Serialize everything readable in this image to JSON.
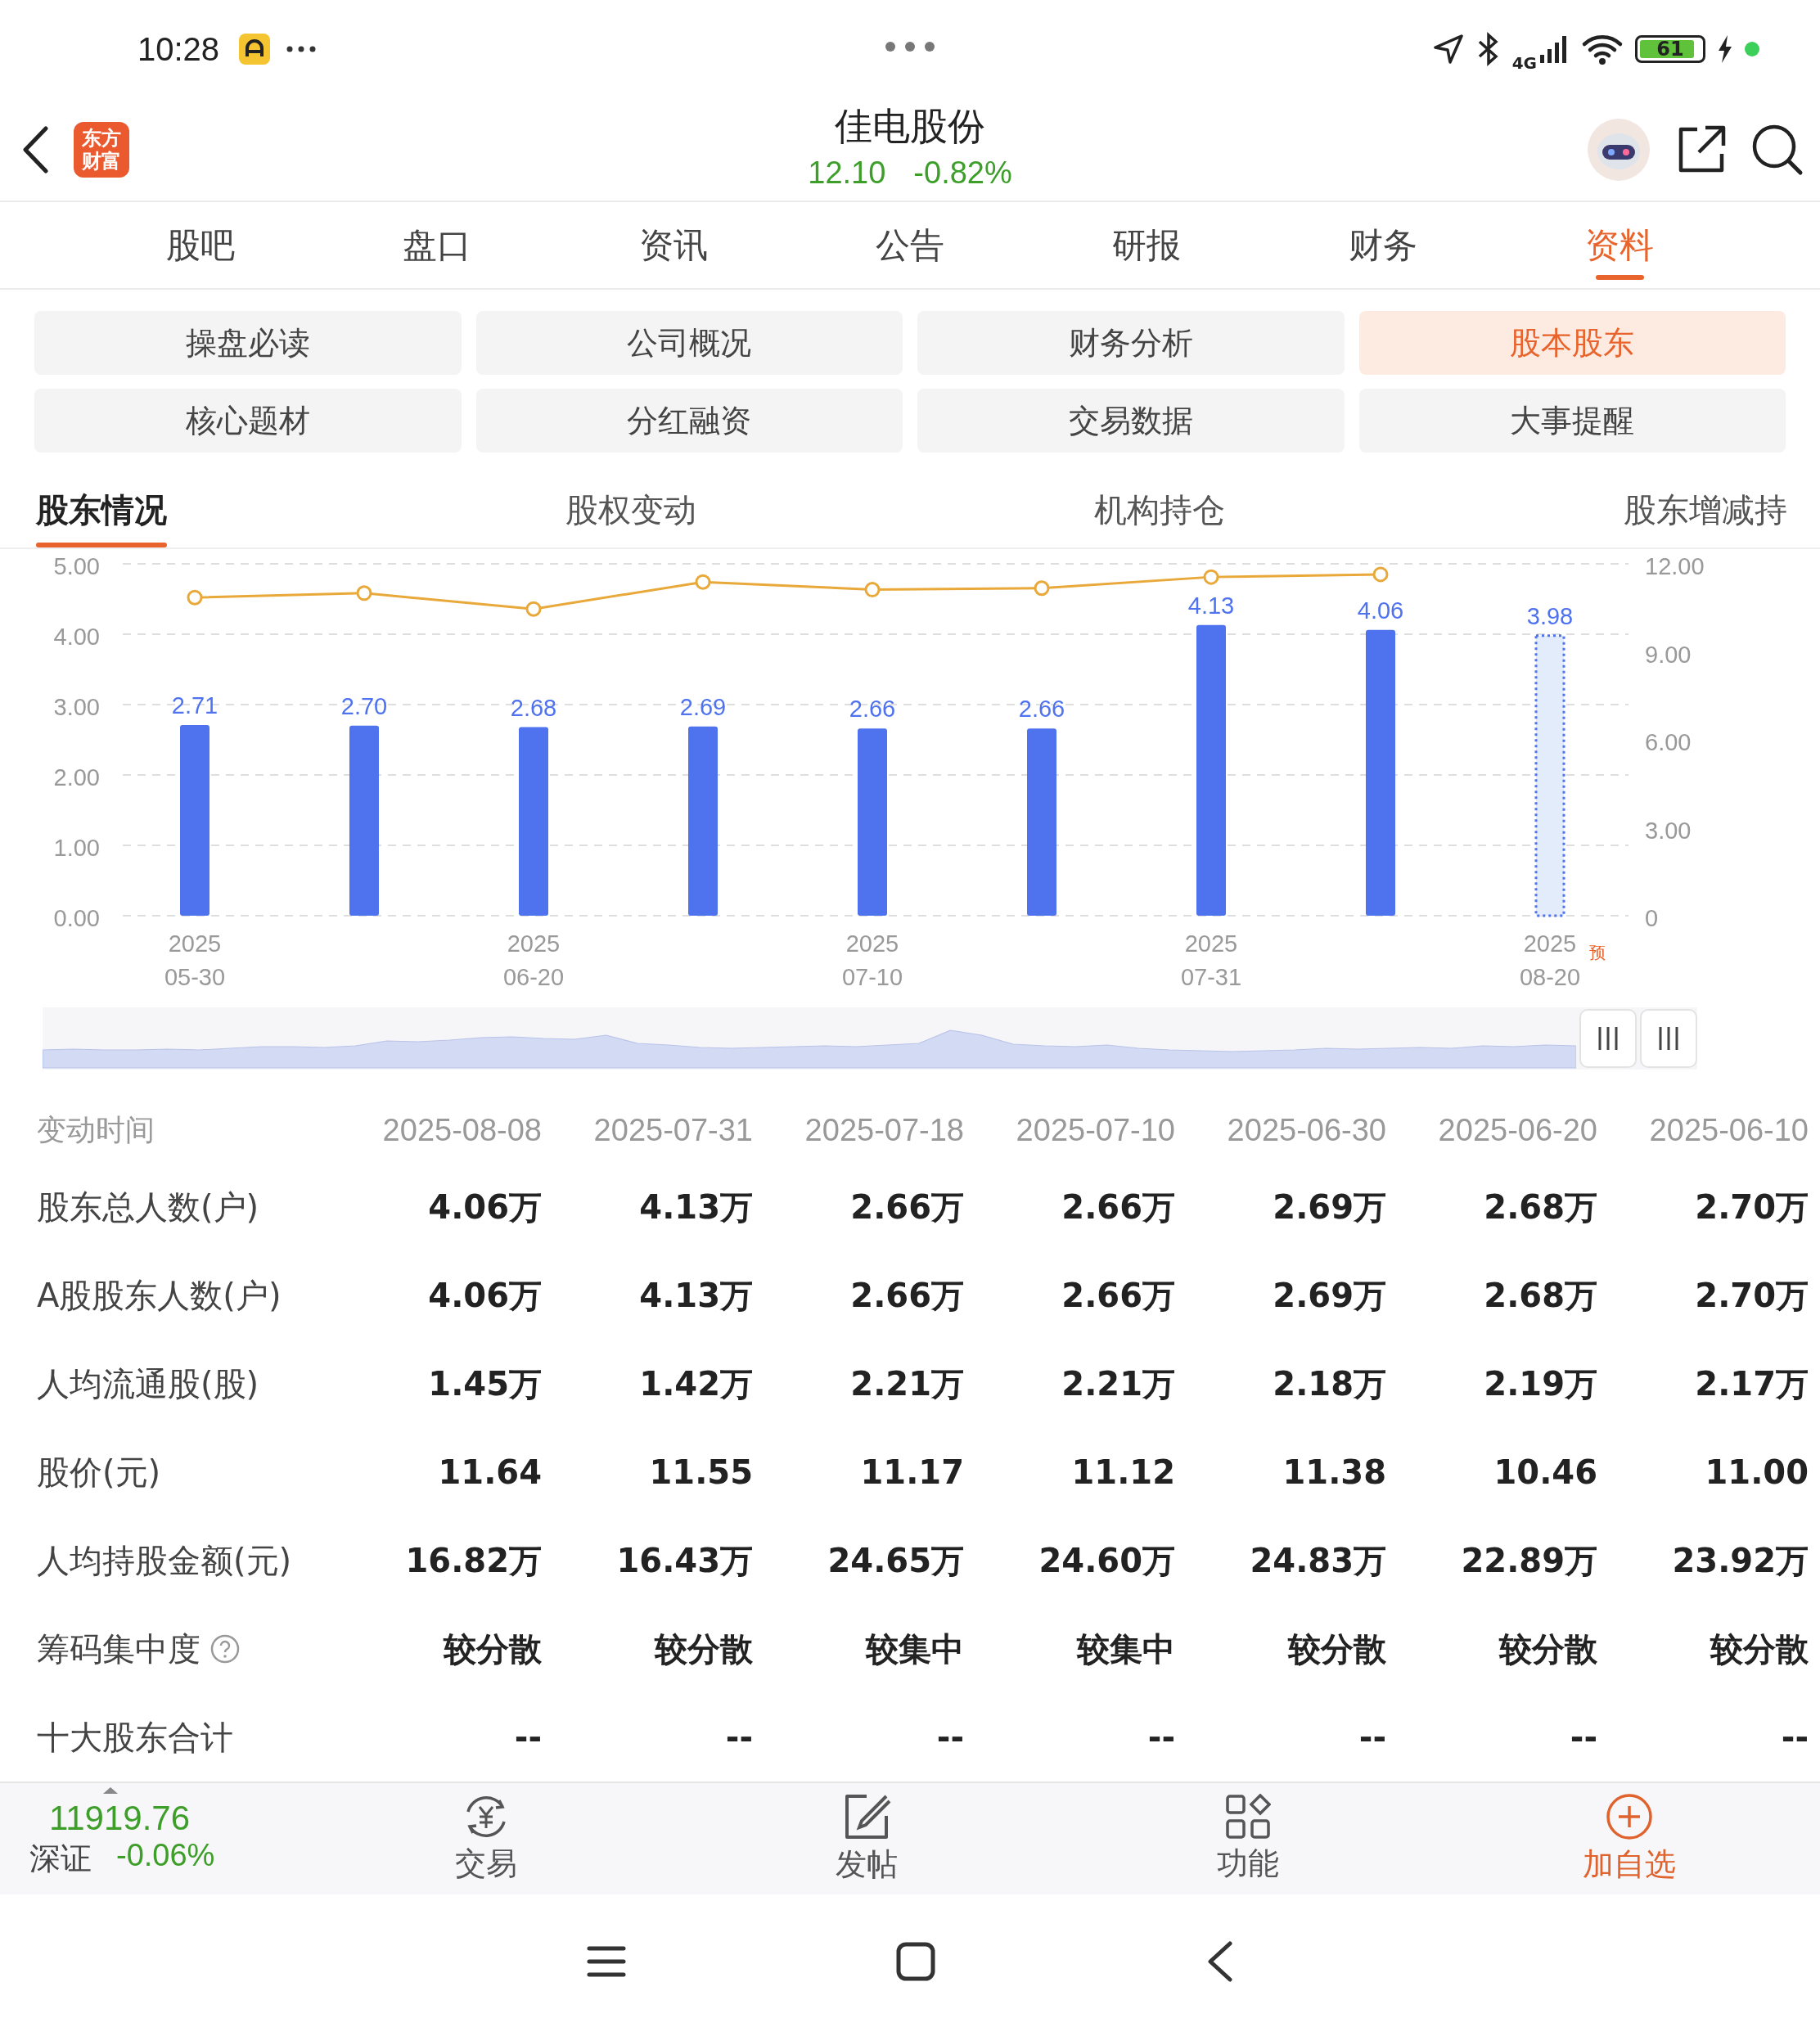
{
  "status_bar": {
    "time": "10:28",
    "network": "4G",
    "battery": "61"
  },
  "header": {
    "logo_lines": [
      "东方",
      "财富"
    ],
    "title": "佳电股份",
    "price": "12.10",
    "change": "-0.82%"
  },
  "tabs": [
    {
      "label": "股吧",
      "selected": false
    },
    {
      "label": "盘口",
      "selected": false
    },
    {
      "label": "资讯",
      "selected": false
    },
    {
      "label": "公告",
      "selected": false
    },
    {
      "label": "研报",
      "selected": false
    },
    {
      "label": "财务",
      "selected": false
    },
    {
      "label": "资料",
      "selected": true
    }
  ],
  "sections": [
    {
      "label": "操盘必读",
      "selected": false
    },
    {
      "label": "公司概况",
      "selected": false
    },
    {
      "label": "财务分析",
      "selected": false
    },
    {
      "label": "股本股东",
      "selected": true
    },
    {
      "label": "核心题材",
      "selected": false
    },
    {
      "label": "分红融资",
      "selected": false
    },
    {
      "label": "交易数据",
      "selected": false
    },
    {
      "label": "大事提醒",
      "selected": false
    }
  ],
  "sub_tabs": [
    {
      "label": "股东情况",
      "selected": true
    },
    {
      "label": "股权变动",
      "selected": false
    },
    {
      "label": "机构持仓",
      "selected": false
    },
    {
      "label": "股东增减持",
      "selected": false
    }
  ],
  "chart_data": {
    "type": "bar",
    "categories": [
      "2025 05-30",
      null,
      "2025 06-20",
      null,
      "2025 07-10",
      null,
      "2025 07-31",
      null,
      "2025 08-20"
    ],
    "ylim": [
      0,
      5
    ],
    "yticks": [
      {
        "value": 0,
        "label": "0.00"
      },
      {
        "value": 1,
        "label": "1.00"
      },
      {
        "value": 2,
        "label": "2.00"
      },
      {
        "value": 3,
        "label": "3.00"
      },
      {
        "value": 4,
        "label": "4.00"
      },
      {
        "value": 5,
        "label": "5.00"
      }
    ],
    "y2lim": [
      0,
      12
    ],
    "y2ticks": [
      {
        "value": 0,
        "label": "0"
      },
      {
        "value": 3,
        "label": "3.00"
      },
      {
        "value": 6,
        "label": "6.00"
      },
      {
        "value": 9,
        "label": "9.00"
      },
      {
        "value": 12,
        "label": "12.00"
      }
    ],
    "grid": true,
    "series": [
      {
        "color": "#4f72ee",
        "values": [
          2.71,
          2.7,
          2.68,
          2.69,
          2.66,
          2.66,
          4.13,
          4.06,
          3.98
        ],
        "value_labels": [
          "2.71",
          "2.70",
          "2.68",
          "2.69",
          "2.66",
          "2.66",
          "4.13",
          "4.06",
          "3.98"
        ]
      },
      {
        "type": "line",
        "axis": "y2",
        "marker": true,
        "color": "#e9a93a",
        "values": [
          10.85,
          11.0,
          10.46,
          11.38,
          11.12,
          11.17,
          11.55,
          11.64,
          null
        ]
      }
    ],
    "annotations": [
      "预"
    ]
  },
  "table": {
    "header_label": "变动时间",
    "columns": [
      "2025-08-08",
      "2025-07-31",
      "2025-07-18",
      "2025-07-10",
      "2025-06-30",
      "2025-06-20",
      "2025-06-10"
    ],
    "rows": [
      {
        "label": "股东总人数(户)",
        "cells": [
          "4.06万",
          "4.13万",
          "2.66万",
          "2.66万",
          "2.69万",
          "2.68万",
          "2.70万"
        ]
      },
      {
        "label": "A股股东人数(户)",
        "cells": [
          "4.06万",
          "4.13万",
          "2.66万",
          "2.66万",
          "2.69万",
          "2.68万",
          "2.70万"
        ]
      },
      {
        "label": "人均流通股(股)",
        "cells": [
          "1.45万",
          "1.42万",
          "2.21万",
          "2.21万",
          "2.18万",
          "2.19万",
          "2.17万"
        ]
      },
      {
        "label": "股价(元)",
        "cells": [
          "11.64",
          "11.55",
          "11.17",
          "11.12",
          "11.38",
          "10.46",
          "11.00"
        ]
      },
      {
        "label": "人均持股金额(元)",
        "cells": [
          "16.82万",
          "16.43万",
          "24.65万",
          "24.60万",
          "24.83万",
          "22.89万",
          "23.92万"
        ]
      },
      {
        "label": "筹码集中度",
        "help": true,
        "cells": [
          "较分散",
          "较分散",
          "较集中",
          "较集中",
          "较分散",
          "较分散",
          "较分散"
        ]
      },
      {
        "label": "十大股东合计",
        "cells": [
          "--",
          "--",
          "--",
          "--",
          "--",
          "--",
          "--"
        ]
      }
    ]
  },
  "bottom_bar": {
    "index_value": "11919.76",
    "index_name": "深证",
    "index_change": "-0.06%",
    "actions": [
      {
        "kind": "trade",
        "label": "交易",
        "highlighted": false
      },
      {
        "kind": "post",
        "label": "发帖",
        "highlighted": false
      },
      {
        "kind": "functions",
        "label": "功能",
        "highlighted": false
      },
      {
        "kind": "add",
        "label": "加自选",
        "highlighted": true
      }
    ]
  }
}
